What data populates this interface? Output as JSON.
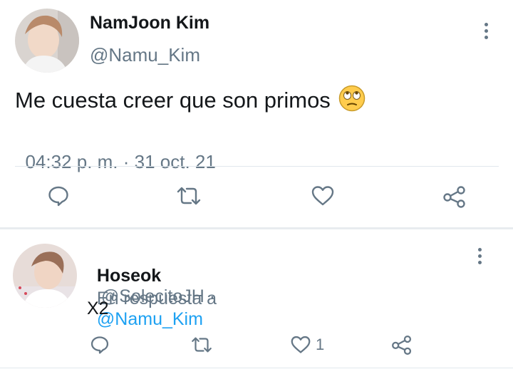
{
  "tweet": {
    "author_name": "NamJoon Kim",
    "author_handle": "@Namu_Kim",
    "text": "Me cuesta creer que son primos",
    "emoji_icon": "face-with-rolling-eyes-icon",
    "time": "04:32 p. m.",
    "separator": " · ",
    "date": "31 oct. 21",
    "actions": [
      "reply-icon",
      "retweet-icon",
      "like-icon",
      "share-icon"
    ]
  },
  "reply": {
    "author_name": "Hoseok",
    "author_handle": "@SolecitoJH",
    "handle_separator": " ·",
    "in_reply_prefix": "En respuesta a",
    "in_reply_handle": "@Namu_Kim",
    "text": "X2",
    "like_count": "1"
  },
  "colors": {
    "text": "#14171a",
    "muted": "#657786",
    "link": "#1da1f2",
    "divider": "#e1e8ed"
  }
}
